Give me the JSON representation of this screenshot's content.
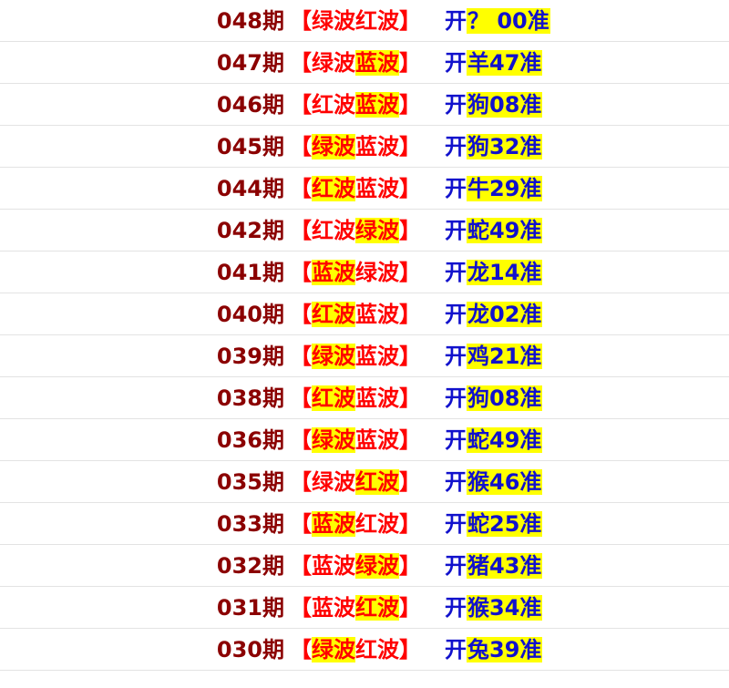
{
  "rows": [
    {
      "issue": "048期",
      "bracket_open": "【",
      "wave1": "绿波",
      "wave2": "红波",
      "bracket_close": "】",
      "kai": "开",
      "result": "？ 00准",
      "hl": [
        0,
        0
      ]
    },
    {
      "issue": "047期",
      "bracket_open": "【",
      "wave1": "绿波",
      "wave2": "蓝波",
      "bracket_close": "】",
      "kai": "开",
      "result": "羊47准",
      "hl": [
        0,
        1
      ]
    },
    {
      "issue": "046期",
      "bracket_open": "【",
      "wave1": "红波",
      "wave2": "蓝波",
      "bracket_close": "】",
      "kai": "开",
      "result": "狗08准",
      "hl": [
        0,
        1
      ]
    },
    {
      "issue": "045期",
      "bracket_open": "【",
      "wave1": "绿波",
      "wave2": "蓝波",
      "bracket_close": "】",
      "kai": "开",
      "result": "狗32准",
      "hl": [
        1,
        0
      ]
    },
    {
      "issue": "044期",
      "bracket_open": "【",
      "wave1": "红波",
      "wave2": "蓝波",
      "bracket_close": "】",
      "kai": "开",
      "result": "牛29准",
      "hl": [
        1,
        0
      ]
    },
    {
      "issue": "042期",
      "bracket_open": "【",
      "wave1": "红波",
      "wave2": "绿波",
      "bracket_close": "】",
      "kai": "开",
      "result": "蛇49准",
      "hl": [
        0,
        1
      ]
    },
    {
      "issue": "041期",
      "bracket_open": "【",
      "wave1": "蓝波",
      "wave2": "绿波",
      "bracket_close": "】",
      "kai": "开",
      "result": "龙14准",
      "hl": [
        1,
        0
      ]
    },
    {
      "issue": "040期",
      "bracket_open": "【",
      "wave1": "红波",
      "wave2": "蓝波",
      "bracket_close": "】",
      "kai": "开",
      "result": "龙02准",
      "hl": [
        1,
        0
      ]
    },
    {
      "issue": "039期",
      "bracket_open": "【",
      "wave1": "绿波",
      "wave2": "蓝波",
      "bracket_close": "】",
      "kai": "开",
      "result": "鸡21准",
      "hl": [
        1,
        0
      ]
    },
    {
      "issue": "038期",
      "bracket_open": "【",
      "wave1": "红波",
      "wave2": "蓝波",
      "bracket_close": "】",
      "kai": "开",
      "result": "狗08准",
      "hl": [
        1,
        0
      ]
    },
    {
      "issue": "036期",
      "bracket_open": "【",
      "wave1": "绿波",
      "wave2": "蓝波",
      "bracket_close": "】",
      "kai": "开",
      "result": "蛇49准",
      "hl": [
        1,
        0
      ]
    },
    {
      "issue": "035期",
      "bracket_open": "【",
      "wave1": "绿波",
      "wave2": "红波",
      "bracket_close": "】",
      "kai": "开",
      "result": "猴46准",
      "hl": [
        0,
        1
      ]
    },
    {
      "issue": "033期",
      "bracket_open": "【",
      "wave1": "蓝波",
      "wave2": "红波",
      "bracket_close": "】",
      "kai": "开",
      "result": "蛇25准",
      "hl": [
        1,
        0
      ]
    },
    {
      "issue": "032期",
      "bracket_open": "【",
      "wave1": "蓝波",
      "wave2": "绿波",
      "bracket_close": "】",
      "kai": "开",
      "result": "猪43准",
      "hl": [
        0,
        1
      ]
    },
    {
      "issue": "031期",
      "bracket_open": "【",
      "wave1": "蓝波",
      "wave2": "红波",
      "bracket_close": "】",
      "kai": "开",
      "result": "猴34准",
      "hl": [
        0,
        1
      ]
    },
    {
      "issue": "030期",
      "bracket_open": "【",
      "wave1": "绿波",
      "wave2": "红波",
      "bracket_close": "】",
      "kai": "开",
      "result": "兔39准",
      "hl": [
        1,
        0
      ]
    }
  ],
  "colors": {
    "issue": "#8b0000",
    "wave": "#ff0000",
    "result": "#1111cc",
    "highlight": "#ffff00"
  }
}
